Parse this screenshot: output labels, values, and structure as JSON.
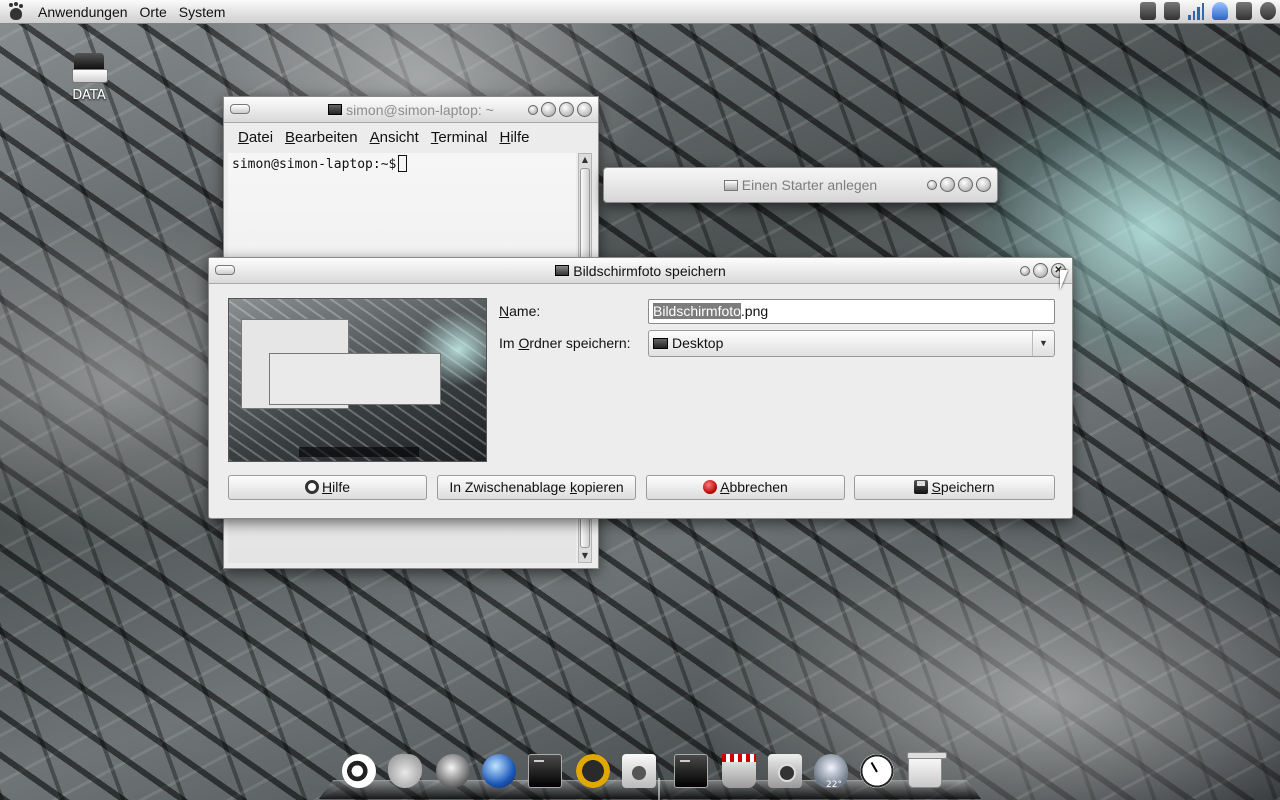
{
  "top_panel": {
    "menus": [
      "Anwendungen",
      "Orte",
      "System"
    ]
  },
  "desktop": {
    "icon_label": "DATA"
  },
  "terminal": {
    "title": "simon@simon-laptop: ~",
    "menu": {
      "file": {
        "accel": "D",
        "rest": "atei"
      },
      "edit": {
        "accel": "B",
        "rest": "earbeiten"
      },
      "view": {
        "accel": "A",
        "rest": "nsicht"
      },
      "terminal": {
        "accel": "T",
        "rest": "erminal"
      },
      "help": {
        "accel": "H",
        "rest": "ilfe"
      }
    },
    "prompt": "simon@simon-laptop:~$"
  },
  "launcher": {
    "title": "Einen Starter anlegen"
  },
  "dialog": {
    "title": "Bildschirmfoto speichern",
    "name_label": {
      "accel": "N",
      "rest": "ame:"
    },
    "filename_selected": "Bildschirmfoto",
    "filename_ext": ".png",
    "folder_label": {
      "pre": "Im ",
      "accel": "O",
      "rest": "rdner speichern:"
    },
    "folder_value": "Desktop",
    "buttons": {
      "help": {
        "accel": "H",
        "rest": "ilfe"
      },
      "copy": {
        "pre": "In Zwischenablage ",
        "accel": "k",
        "rest": "opieren"
      },
      "cancel": {
        "accel": "A",
        "rest": "bbrechen"
      },
      "save": {
        "accel": "S",
        "rest": "peichern"
      }
    }
  },
  "dock": {
    "temperature": "22°"
  },
  "colors": {
    "selection": "#7d7d7d",
    "window_bg": "#ededed"
  }
}
